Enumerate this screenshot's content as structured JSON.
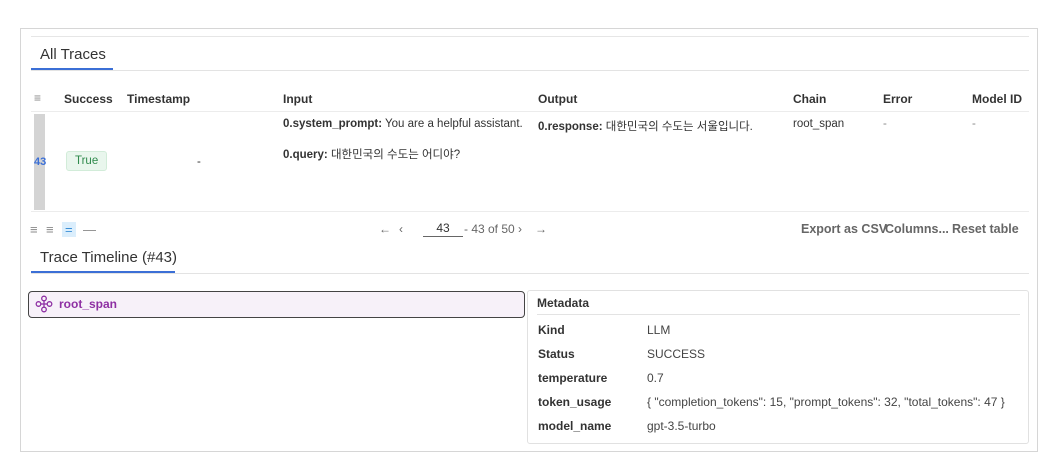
{
  "tabs": {
    "all_traces": "All Traces",
    "trace_timeline": "Trace Timeline (#43)"
  },
  "table": {
    "headers": {
      "success": "Success",
      "timestamp": "Timestamp",
      "input": "Input",
      "output": "Output",
      "chain": "Chain",
      "error": "Error",
      "model_id": "Model ID"
    },
    "row": {
      "id": "43",
      "success": "True",
      "timestamp": "-",
      "input_system_key": "0.system_prompt:",
      "input_system_val": " You are a helpful assistant.",
      "input_query_key": "0.query:",
      "input_query_val": " 대한민국의 수도는 어디야?",
      "output_key": "0.response:",
      "output_val": " 대한민국의 수도는 서울입니다.",
      "chain": "root_span",
      "error": "-",
      "model_id": "-"
    }
  },
  "toolbar": {
    "pager_prev_all": "←",
    "pager_prev": "‹",
    "pager_page": "43",
    "pager_range": "- 43 of 50",
    "pager_next": "›",
    "pager_next_all": "→",
    "export_csv": "Export as CSV",
    "columns": "Columns...",
    "reset_table": "Reset table"
  },
  "timeline": {
    "span_name": "root_span",
    "metadata_title": "Metadata",
    "metadata": [
      {
        "key": "Kind",
        "value": "LLM"
      },
      {
        "key": "Status",
        "value": "SUCCESS"
      },
      {
        "key": "temperature",
        "value": "0.7"
      },
      {
        "key": "token_usage",
        "value": "{ \"completion_tokens\": 15, \"prompt_tokens\": 32, \"total_tokens\": 47 }"
      },
      {
        "key": "model_name",
        "value": "gpt-3.5-turbo"
      }
    ]
  },
  "colors": {
    "accent": "#3b6fd6",
    "success": "#2f8a4c",
    "span": "#8e2fa3"
  }
}
